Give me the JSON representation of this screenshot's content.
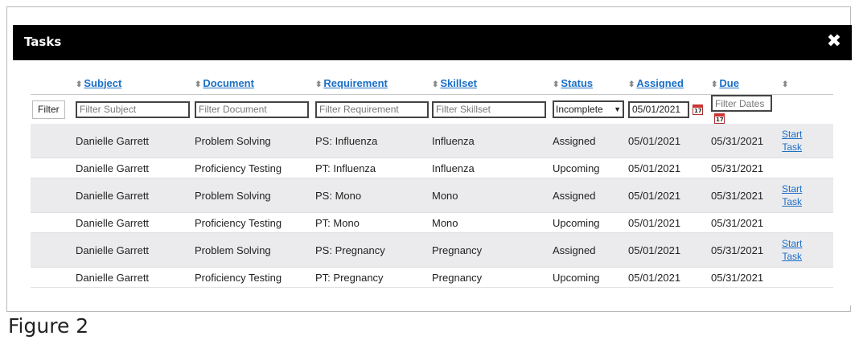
{
  "window": {
    "title": "Tasks",
    "close_symbol": "✖"
  },
  "caption": "Figure 2",
  "table": {
    "columns": [
      {
        "key": "subject",
        "label": "Subject"
      },
      {
        "key": "document",
        "label": "Document"
      },
      {
        "key": "requirement",
        "label": "Requirement"
      },
      {
        "key": "skillset",
        "label": "Skillset"
      },
      {
        "key": "status",
        "label": "Status"
      },
      {
        "key": "assigned",
        "label": "Assigned"
      },
      {
        "key": "due",
        "label": "Due"
      }
    ],
    "sort_symbol": "⬍",
    "filters": {
      "button_label": "Filter",
      "subject_placeholder": "Filter Subject",
      "document_placeholder": "Filter Document",
      "requirement_placeholder": "Filter Requirement",
      "skillset_placeholder": "Filter Skillset",
      "status_value": "Incomplete",
      "assigned_value": "05/01/2021",
      "due_placeholder": "Filter Dates",
      "calendar_day": "17"
    },
    "rows": [
      {
        "subject": "Danielle Garrett",
        "document": "Problem Solving",
        "requirement": "PS: Influenza",
        "skillset": "Influenza",
        "status": "Assigned",
        "assigned": "05/01/2021",
        "due": "05/31/2021",
        "action_line1": "Start",
        "action_line2": "Task"
      },
      {
        "subject": "Danielle Garrett",
        "document": "Proficiency Testing",
        "requirement": "PT: Influenza",
        "skillset": "Influenza",
        "status": "Upcoming",
        "assigned": "05/01/2021",
        "due": "05/31/2021"
      },
      {
        "subject": "Danielle Garrett",
        "document": "Problem Solving",
        "requirement": "PS: Mono",
        "skillset": "Mono",
        "status": "Assigned",
        "assigned": "05/01/2021",
        "due": "05/31/2021",
        "action_line1": "Start",
        "action_line2": "Task"
      },
      {
        "subject": "Danielle Garrett",
        "document": "Proficiency Testing",
        "requirement": "PT: Mono",
        "skillset": "Mono",
        "status": "Upcoming",
        "assigned": "05/01/2021",
        "due": "05/31/2021"
      },
      {
        "subject": "Danielle Garrett",
        "document": "Problem Solving",
        "requirement": "PS: Pregnancy",
        "skillset": "Pregnancy",
        "status": "Assigned",
        "assigned": "05/01/2021",
        "due": "05/31/2021",
        "action_line1": "Start",
        "action_line2": "Task"
      },
      {
        "subject": "Danielle Garrett",
        "document": "Proficiency Testing",
        "requirement": "PT: Pregnancy",
        "skillset": "Pregnancy",
        "status": "Upcoming",
        "assigned": "05/01/2021",
        "due": "05/31/2021"
      }
    ]
  }
}
